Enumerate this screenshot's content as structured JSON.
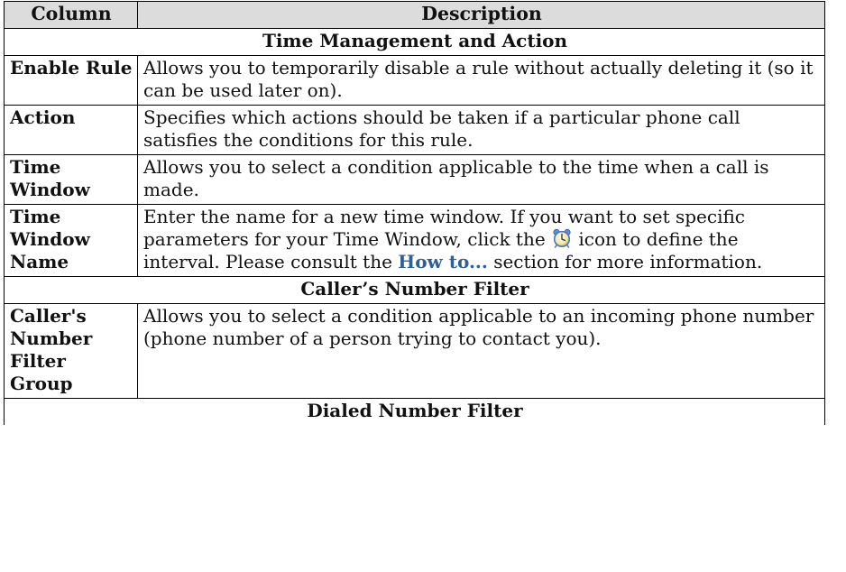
{
  "header": {
    "column": "Column",
    "description": "Description"
  },
  "sections": {
    "time_mgmt": "Time Management and Action",
    "caller_filter": "Caller’s Number Filter",
    "dialed_filter": "Dialed Number Filter"
  },
  "rows": {
    "enable_rule": {
      "name": "Enable Rule",
      "desc": "Allows you to temporarily disable a rule without actually deleting it (so it can be used later on)."
    },
    "action": {
      "name": "Action",
      "desc": "Specifies which actions should be taken if a particular phone call satisfies the conditions for this rule."
    },
    "time_window": {
      "name": "Time Window",
      "desc": "Allows you to select a condition applicable to the time when a call is made."
    },
    "time_window_name": {
      "name": "Time Window Name",
      "desc_part1": "Enter the name for a new time window. If you want to set specific parameters for your Time Window, click the",
      "desc_part2": "icon to define the interval. Please consult the",
      "link_text": "How to...",
      "desc_part3": "section for more information.",
      "icon": "alarm-clock-icon"
    },
    "caller_group": {
      "name": "Caller's Number Filter Group",
      "desc": "Allows you to select a condition applicable to an incoming phone number (phone number of a person trying to contact you)."
    }
  },
  "colors": {
    "header_bg": "#dcdcdc",
    "link": "#2e5f98",
    "border": "#000000"
  }
}
